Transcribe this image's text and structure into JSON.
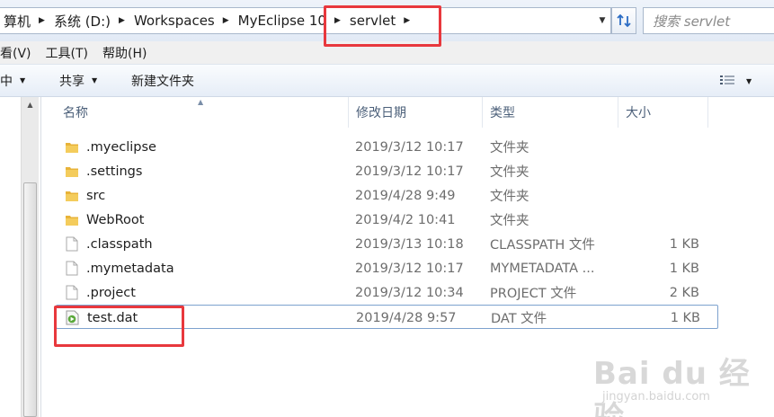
{
  "address": {
    "crumbs": [
      {
        "label": "算机"
      },
      {
        "label": "系统 (D:)"
      },
      {
        "label": "Workspaces"
      },
      {
        "label": "MyEclipse 10"
      },
      {
        "label": "servlet"
      }
    ]
  },
  "search": {
    "placeholder": "搜索 servlet"
  },
  "menu": [
    {
      "label": "看(V)"
    },
    {
      "label": "工具(T)"
    },
    {
      "label": "帮助(H)"
    }
  ],
  "toolbar": {
    "include_label": "中",
    "share_label": "共享",
    "new_folder_label": "新建文件夹"
  },
  "columns": {
    "name": "名称",
    "date": "修改日期",
    "type": "类型",
    "size": "大小"
  },
  "files": [
    {
      "name": ".myeclipse",
      "date": "2019/3/12 10:17",
      "type": "文件夹",
      "size": "",
      "icon": "folder-icon"
    },
    {
      "name": ".settings",
      "date": "2019/3/12 10:17",
      "type": "文件夹",
      "size": "",
      "icon": "folder-icon"
    },
    {
      "name": "src",
      "date": "2019/4/28 9:49",
      "type": "文件夹",
      "size": "",
      "icon": "folder-icon"
    },
    {
      "name": "WebRoot",
      "date": "2019/4/2 10:41",
      "type": "文件夹",
      "size": "",
      "icon": "folder-icon"
    },
    {
      "name": ".classpath",
      "date": "2019/3/13 10:18",
      "type": "CLASSPATH 文件",
      "size": "1 KB",
      "icon": "file-icon"
    },
    {
      "name": ".mymetadata",
      "date": "2019/3/12 10:17",
      "type": "MYMETADATA ...",
      "size": "1 KB",
      "icon": "file-icon"
    },
    {
      "name": ".project",
      "date": "2019/3/12 10:34",
      "type": "PROJECT 文件",
      "size": "2 KB",
      "icon": "file-icon"
    },
    {
      "name": "test.dat",
      "date": "2019/4/28 9:57",
      "type": "DAT 文件",
      "size": "1 KB",
      "icon": "media-file-icon"
    }
  ],
  "watermark": {
    "brand": "Bai du 经验",
    "url": "jingyan.baidu.com"
  },
  "colors": {
    "annotation": "#e8383d",
    "selection_border": "#7da2ce",
    "folder": "#e8b339"
  }
}
